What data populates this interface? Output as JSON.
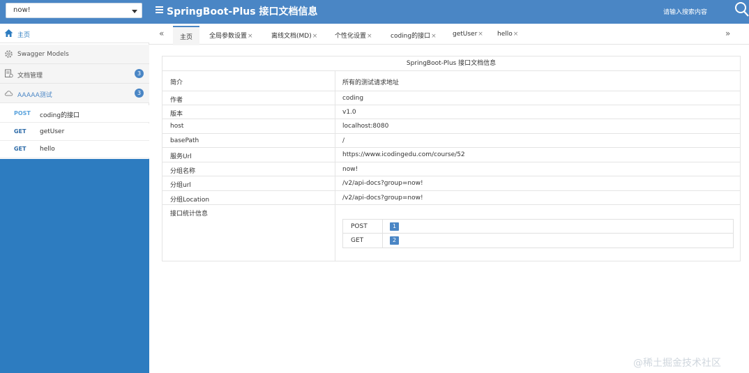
{
  "header": {
    "group_selected": "now!",
    "title": "SpringBoot-Plus 接口文档信息",
    "search_placeholder": "请输入搜索内容"
  },
  "sidebar": {
    "items": [
      {
        "label": "主页",
        "icon": "home-icon"
      },
      {
        "label": "Swagger Models",
        "icon": "gear-icon"
      },
      {
        "label": "文档管理",
        "icon": "document-icon",
        "badge": "3"
      },
      {
        "label": "AAAAA测试",
        "icon": "cloud-icon",
        "badge": "3"
      }
    ],
    "apis": [
      {
        "method": "POST",
        "name": "coding的接口"
      },
      {
        "method": "GET",
        "name": "getUser"
      },
      {
        "method": "GET",
        "name": "hello"
      }
    ]
  },
  "tabs": {
    "prev": "«",
    "next": "»",
    "close": "×",
    "items": [
      {
        "label": "主页"
      },
      {
        "label": "全局参数设置"
      },
      {
        "label": "离线文档(MD)"
      },
      {
        "label": "个性化设置"
      },
      {
        "label": "coding的接口"
      },
      {
        "label": "getUser"
      },
      {
        "label": "hello"
      }
    ]
  },
  "doc": {
    "title": "SpringBoot-Plus 接口文档信息",
    "rows": [
      {
        "key": "简介",
        "value": "所有的测试请求地址"
      },
      {
        "key": "作者",
        "value": "coding"
      },
      {
        "key": "版本",
        "value": "v1.0"
      },
      {
        "key": "host",
        "value": "localhost:8080"
      },
      {
        "key": "basePath",
        "value": "/"
      },
      {
        "key": "服务Url",
        "value": "https://www.icodingedu.com/course/52"
      },
      {
        "key": "分组名称",
        "value": "now!"
      },
      {
        "key": "分组url",
        "value": "/v2/api-docs?group=now!"
      },
      {
        "key": "分组Location",
        "value": "/v2/api-docs?group=now!"
      },
      {
        "key": "接口统计信息",
        "value": ""
      }
    ],
    "stats": [
      {
        "method": "POST",
        "count": "1"
      },
      {
        "method": "GET",
        "count": "2"
      }
    ]
  },
  "watermark": "@稀土掘金技术社区"
}
